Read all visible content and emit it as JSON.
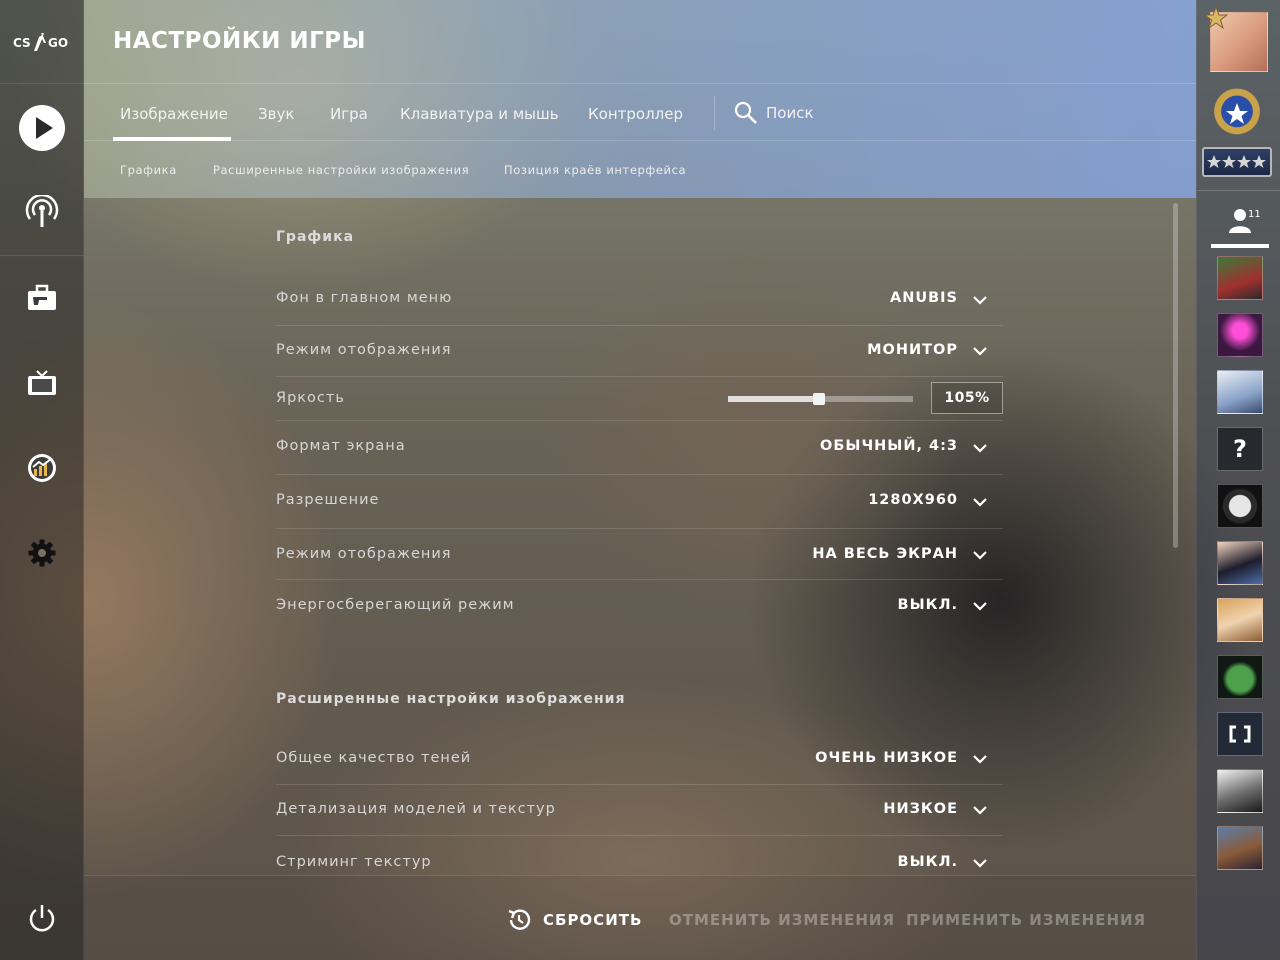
{
  "app": {
    "logo_text": "CS:GO",
    "title": "НАСТРОЙКИ ИГРЫ"
  },
  "left_nav": {
    "icons": [
      "play-icon",
      "broadcast-icon",
      "inventory-briefcase-icon",
      "watch-tv-icon",
      "stats-icon",
      "settings-gear-icon",
      "power-icon"
    ]
  },
  "tabs": [
    {
      "label": "Изображение",
      "active": true
    },
    {
      "label": "Звук",
      "active": false
    },
    {
      "label": "Игра",
      "active": false
    },
    {
      "label": "Клавиатура и мышь",
      "active": false
    },
    {
      "label": "Контроллер",
      "active": false
    }
  ],
  "search": {
    "label": "Поиск"
  },
  "subtabs": [
    "Графика",
    "Расширенные настройки изображения",
    "Позиция краёв интерфейса"
  ],
  "sections": {
    "graphics": {
      "title": "Графика",
      "rows": [
        {
          "label": "Фон в главном меню",
          "value": "ANUBIS"
        },
        {
          "label": "Режим отображения",
          "value": "МОНИТОР"
        },
        {
          "label": "Яркость",
          "value": "105%",
          "slider_fraction": 0.49
        },
        {
          "label": "Формат экрана",
          "value": "ОБЫЧНЫЙ, 4:3"
        },
        {
          "label": "Разрешение",
          "value": "1280X960"
        },
        {
          "label": "Режим отображения",
          "value": "НА ВЕСЬ ЭКРАН"
        },
        {
          "label": "Энергосберегающий режим",
          "value": "ВЫКЛ."
        }
      ]
    },
    "advanced": {
      "title": "Расширенные настройки изображения",
      "rows": [
        {
          "label": "Общее качество теней",
          "value": "ОЧЕНЬ НИЗКОЕ"
        },
        {
          "label": "Детализация моделей и текстур",
          "value": "НИЗКОЕ"
        },
        {
          "label": "Стриминг текстур",
          "value": "ВЫКЛ."
        }
      ]
    }
  },
  "footer": {
    "reset": "СБРОСИТЬ",
    "cancel": "ОТМЕНИТЬ ИЗМЕНЕНИЯ",
    "apply": "ПРИМЕНИТЬ ИЗМЕНЕНИЯ"
  },
  "right_bar": {
    "friend_count": "11",
    "friend_unknown_glyph": "?"
  },
  "colors": {
    "accent": "#ffffff",
    "disabled_text": "#8a8a8a",
    "rank_blue": "#2b4fa8",
    "rank_gold": "#c9a24a"
  }
}
